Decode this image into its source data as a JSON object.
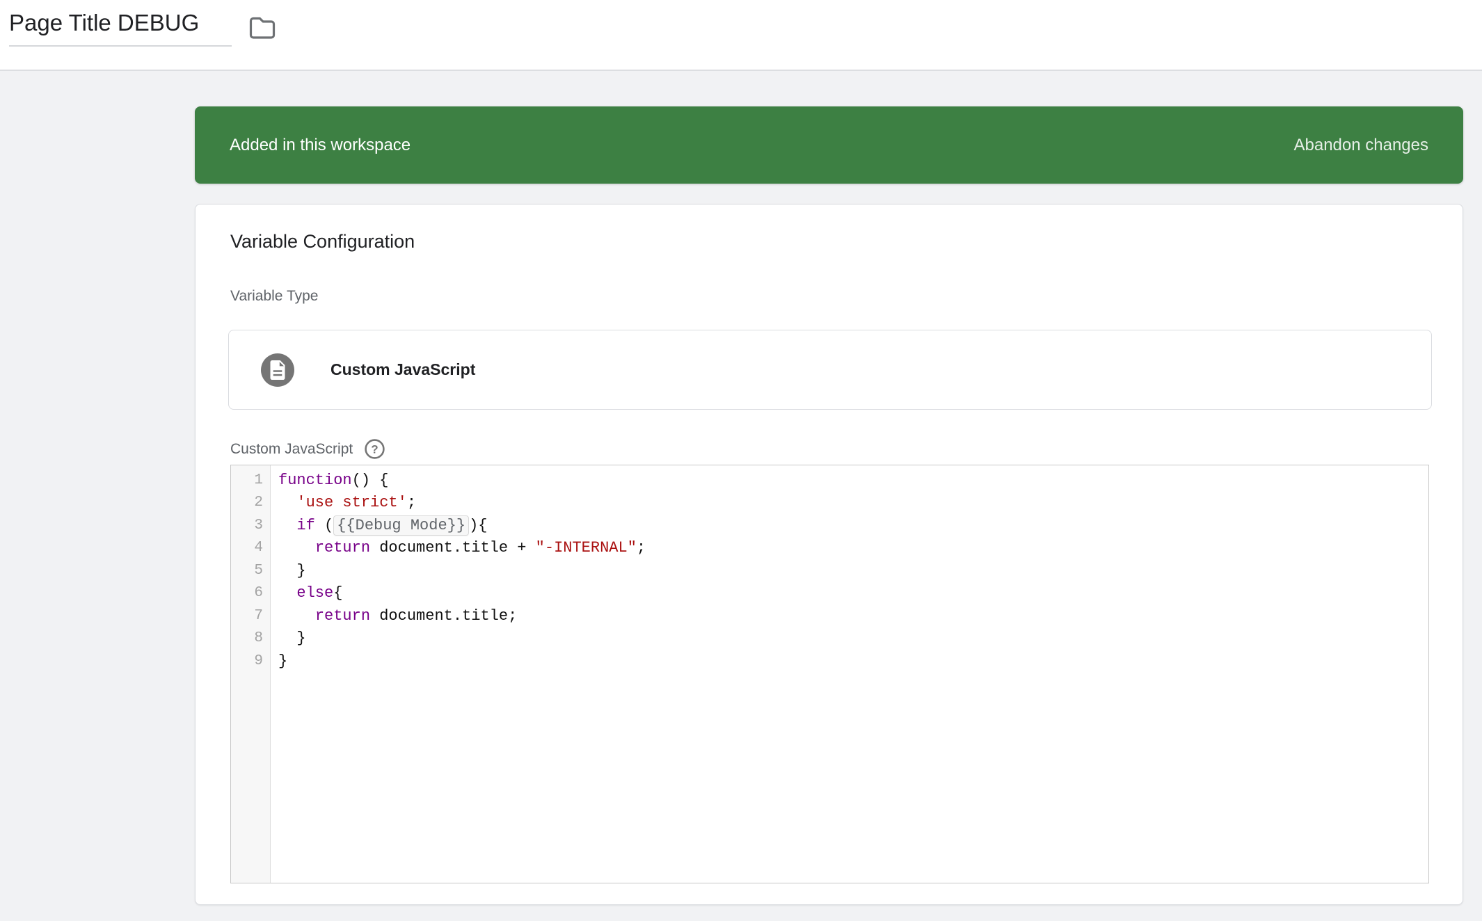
{
  "header": {
    "title": "Page Title DEBUG"
  },
  "banner": {
    "message": "Added in this workspace",
    "action_label": "Abandon changes"
  },
  "card": {
    "title": "Variable Configuration",
    "variable_type": {
      "label": "Variable Type",
      "value": "Custom JavaScript"
    },
    "editor": {
      "label": "Custom JavaScript",
      "language": "javascript",
      "full_text": "function() {\n  'use strict';\n  if ({{Debug Mode}}){\n    return document.title + \"-INTERNAL\";\n  }\n  else{\n    return document.title;\n  }\n}",
      "lines": [
        {
          "number": "1",
          "segments": [
            {
              "text": "function",
              "type": "keyword"
            },
            {
              "text": "() {",
              "type": "plain"
            }
          ]
        },
        {
          "number": "2",
          "segments": [
            {
              "text": "  ",
              "type": "plain"
            },
            {
              "text": "'use strict'",
              "type": "string"
            },
            {
              "text": ";",
              "type": "plain"
            }
          ]
        },
        {
          "number": "3",
          "segments": [
            {
              "text": "  ",
              "type": "plain"
            },
            {
              "text": "if",
              "type": "keyword"
            },
            {
              "text": " (",
              "type": "plain"
            },
            {
              "text": "{{Debug Mode}}",
              "type": "chip"
            },
            {
              "text": "){",
              "type": "plain"
            }
          ]
        },
        {
          "number": "4",
          "segments": [
            {
              "text": "    ",
              "type": "plain"
            },
            {
              "text": "return",
              "type": "keyword"
            },
            {
              "text": " document.title + ",
              "type": "plain"
            },
            {
              "text": "\"-INTERNAL\"",
              "type": "string"
            },
            {
              "text": ";",
              "type": "plain"
            }
          ]
        },
        {
          "number": "5",
          "segments": [
            {
              "text": "  }",
              "type": "plain"
            }
          ]
        },
        {
          "number": "6",
          "segments": [
            {
              "text": "  ",
              "type": "plain"
            },
            {
              "text": "else",
              "type": "keyword"
            },
            {
              "text": "{",
              "type": "plain"
            }
          ]
        },
        {
          "number": "7",
          "segments": [
            {
              "text": "    ",
              "type": "plain"
            },
            {
              "text": "return",
              "type": "keyword"
            },
            {
              "text": " document.title;",
              "type": "plain"
            }
          ]
        },
        {
          "number": "8",
          "segments": [
            {
              "text": "  }",
              "type": "plain"
            }
          ]
        },
        {
          "number": "9",
          "segments": [
            {
              "text": "}",
              "type": "plain"
            }
          ]
        }
      ]
    }
  },
  "icons": {
    "folder": "folder-icon",
    "variable_type": "document-icon",
    "help": "help-icon"
  },
  "colors": {
    "banner_green": "#3d8043",
    "keyword_purple": "#770088",
    "string_red": "#aa1111",
    "chip_text_gray": "#5f6368"
  }
}
